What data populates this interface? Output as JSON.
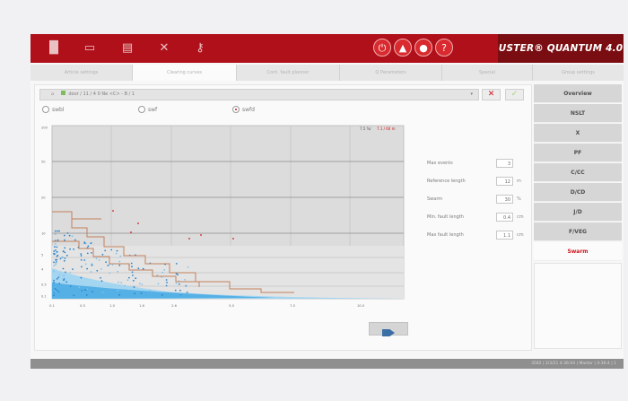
{
  "brand": {
    "name": "USTER® QUANTUM 4.0"
  },
  "toolbar": {
    "icons": [
      "chart-icon",
      "folder-icon",
      "sheets-icon",
      "tools-icon",
      "key-icon"
    ]
  },
  "alerts": {
    "icons": [
      "power-icon",
      "warning-icon",
      "user-icon",
      "help-icon"
    ]
  },
  "tabs": [
    {
      "label": "Article settings"
    },
    {
      "label": "Clearing curves"
    },
    {
      "label": "Cont. fault planner"
    },
    {
      "label": "Q Parameters"
    },
    {
      "label": "Special"
    },
    {
      "label": "Group settings"
    }
  ],
  "path": {
    "text": "door / 11 / 4 0 Ne  <C> - B / 1"
  },
  "radios": [
    {
      "label": "swbl",
      "selected": false
    },
    {
      "label": "swf",
      "selected": false
    },
    {
      "label": "swfd",
      "selected": true
    }
  ],
  "chart_data": {
    "type": "scatter",
    "legend": {
      "position": "top-right",
      "text_black": "7.5 %/",
      "text_red": "7.1 / 60 m"
    },
    "y_ticks": [
      "200",
      "50",
      "20",
      "10",
      "5",
      "4",
      "0.5",
      "0.1"
    ],
    "x_ticks": [
      "0.1",
      "0.5",
      "1.0",
      "1.6",
      "2.6",
      "5.0",
      "7.5",
      "10.0"
    ],
    "clearing_curves": [
      {
        "name": "outer",
        "color": "#c98565"
      },
      {
        "name": "inner",
        "color": "#c98565"
      }
    ]
  },
  "params": [
    {
      "label": "Max events",
      "value": "3",
      "unit": ""
    },
    {
      "label": "Reference length",
      "value": "12",
      "unit": "m"
    },
    {
      "label": "Swarm",
      "value": "30",
      "unit": "%"
    },
    {
      "label": "Min. fault length",
      "value": "0.4",
      "unit": "cm"
    },
    {
      "label": "Max fault length",
      "value": "1.1",
      "unit": "cm"
    }
  ],
  "sidenav": [
    {
      "label": "Overview"
    },
    {
      "label": "NSLT"
    },
    {
      "label": "X"
    },
    {
      "label": "PF"
    },
    {
      "label": "C/CC"
    },
    {
      "label": "D/CD"
    },
    {
      "label": "J/D"
    },
    {
      "label": "F/VEG"
    },
    {
      "label": "Swarm"
    }
  ],
  "status": {
    "text": "3582  |  2/3/21 4:36:04  |  Master  |  4:36:4  |  1"
  },
  "colors": {
    "brand": "#b0101a",
    "accent": "#c0161e",
    "data": "#3f9fd8"
  }
}
